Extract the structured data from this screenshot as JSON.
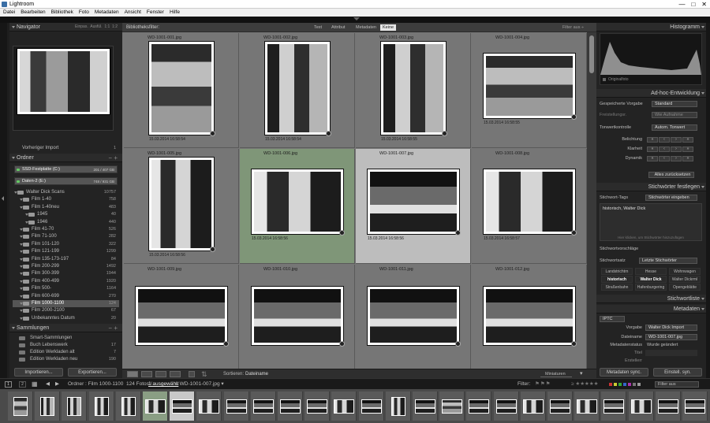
{
  "window": {
    "title": "Lightroom",
    "buttons": [
      "—",
      "□",
      "✕"
    ]
  },
  "menu": [
    "Datei",
    "Bearbeiten",
    "Bibliothek",
    "Foto",
    "Metadaten",
    "Ansicht",
    "Fenster",
    "Hilfe"
  ],
  "left": {
    "navigator": {
      "title": "Navigator",
      "options": [
        "Einpas.",
        "Ausfül.",
        "1:1",
        "1:2"
      ]
    },
    "catalog_items": [
      {
        "label": "Vorheriger Import",
        "count": "1"
      }
    ],
    "folders": {
      "title": "Ordner",
      "drives": [
        {
          "label": "SSD-Festplatte (C:)",
          "info": "201 / 407 GB"
        },
        {
          "label": "Daten-2 (E:)",
          "info": "748 / 931 GB"
        }
      ],
      "items": [
        {
          "label": "Walter Dick Scans",
          "count": "10757",
          "level": 1
        },
        {
          "label": "Film 1-40",
          "count": "758",
          "level": 2
        },
        {
          "label": "Film 1-40neu",
          "count": "483",
          "level": 2
        },
        {
          "label": "1945",
          "count": "40",
          "level": 3
        },
        {
          "label": "1946",
          "count": "440",
          "level": 3
        },
        {
          "label": "Film 41-70",
          "count": "526",
          "level": 2
        },
        {
          "label": "Film 71-100",
          "count": "282",
          "level": 2
        },
        {
          "label": "Film 101-120",
          "count": "322",
          "level": 2
        },
        {
          "label": "Film 121-199",
          "count": "1299",
          "level": 2
        },
        {
          "label": "Film 135-173-197",
          "count": "84",
          "level": 2
        },
        {
          "label": "Film 200-299",
          "count": "1492",
          "level": 2
        },
        {
          "label": "Film 300-399",
          "count": "1944",
          "level": 2
        },
        {
          "label": "Film 400-499",
          "count": "1920",
          "level": 2
        },
        {
          "label": "Film 500-",
          "count": "1164",
          "level": 2
        },
        {
          "label": "Film 600-699",
          "count": "270",
          "level": 2
        },
        {
          "label": "Film 1000-1100",
          "count": "124",
          "level": 2,
          "selected": true
        },
        {
          "label": "Film 2000-2100",
          "count": "67",
          "level": 2
        },
        {
          "label": "Unbekanntes Datum",
          "count": "20",
          "level": 2
        }
      ]
    },
    "collections": {
      "title": "Sammlungen",
      "items": [
        {
          "label": "Smart-Sammlungen",
          "count": ""
        },
        {
          "label": "Buch Lebenswerk",
          "count": "17"
        },
        {
          "label": "Edition Werkladen alt",
          "count": "7"
        },
        {
          "label": "Edition Werkladen neu",
          "count": "190"
        }
      ]
    },
    "import_btn": "Importieren...",
    "export_btn": "Exportieren..."
  },
  "filter": {
    "title": "Bibliotheksfilter:",
    "tabs": [
      "Text",
      "Attribut",
      "Metadaten",
      "Keine"
    ],
    "active": "Keine",
    "preset": "Filter aus ÷"
  },
  "grid": [
    {
      "name": "WD-1001-001.jpg",
      "date": "15.03.2014 16:58:54",
      "tone": "a",
      "portrait": true
    },
    {
      "name": "WD-1001-002.jpg",
      "date": "15.03.2014 16:58:54",
      "tone": "b",
      "portrait": true
    },
    {
      "name": "WD-1001-003.jpg",
      "date": "15.03.2014 16:58:55",
      "tone": "b",
      "portrait": true
    },
    {
      "name": "WD-1001-004.jpg",
      "date": "15.03.2014 16:58:55",
      "tone": "a",
      "portrait": false
    },
    {
      "name": "WD-1001-005.jpg",
      "date": "15.03.2014 16:58:56",
      "tone": "c",
      "portrait": true
    },
    {
      "name": "WD-1001-006.jpg",
      "date": "15.03.2014 16:58:56",
      "tone": "c",
      "portrait": false
    },
    {
      "name": "WD-1001-007.jpg",
      "date": "15.03.2014 16:58:56",
      "tone": "d",
      "portrait": false
    },
    {
      "name": "WD-1001-008.jpg",
      "date": "15.03.2014 16:58:57",
      "tone": "c",
      "portrait": false
    },
    {
      "name": "WD-1001-009.jpg",
      "date": "",
      "tone": "d",
      "portrait": false
    },
    {
      "name": "WD-1001-010.jpg",
      "date": "",
      "tone": "d",
      "portrait": false
    },
    {
      "name": "WD-1001-011.jpg",
      "date": "",
      "tone": "d",
      "portrait": false
    },
    {
      "name": "WD-1001-012.jpg",
      "date": "",
      "tone": "d",
      "portrait": false
    }
  ],
  "toolbar": {
    "sort_label": "Sortieren:",
    "sort_value": "Dateiname",
    "thumb_label": "Miniaturen"
  },
  "right": {
    "histogram": {
      "title": "Histogramm",
      "original": "Originalfoto"
    },
    "quick": {
      "title": "Ad-hoc-Entwicklung",
      "preset_label": "Gespeicherte Vorgabe",
      "preset_value": "Standard",
      "crop_label": "Freistellungsr.",
      "crop_value": "Wie Aufnahme",
      "tone_label": "Tonwertkontrolle",
      "tone_value": "Autom. Tonwert",
      "rows": [
        "Belichtung",
        "Klarheit",
        "Dynamik"
      ],
      "reset": "Alles zurücksetzen"
    },
    "keywording": {
      "title": "Stichwörter festlegen",
      "tags_label": "Stichwort-Tags",
      "tags_value": "Stichwörter eingeben",
      "text": "historisch, Walter Dick",
      "hint": "Hier klicken, um Stichwörter hinzuzufügen",
      "suggest": "Stichwortvorschläge",
      "set_label": "Stichwortsatz",
      "set_value": "Letzte Stichwörter",
      "keywords": [
        "Landstrichtrn",
        "Hesse",
        "Wohnwagen",
        "historisch",
        "Walter Dick",
        "Walter Dickrml",
        "Straßenbahn",
        "Hafenburgering",
        "Opengeblätte"
      ]
    },
    "kwlist": {
      "title": "Stichwortliste"
    },
    "metadata": {
      "title": "Metadaten",
      "preset_label": "IPTC",
      "vorgabe_label": "Vorgabe",
      "vorgabe_value": "Walter Dick Import",
      "filename_label": "Dateiname",
      "filename_value": "WD-1001-007.jpg",
      "status_label": "Metadatenstatus",
      "status_value": "Wurde geändert",
      "title_label": "Titel",
      "caption_label": "Erstellerr"
    },
    "sync_meta": "Metadaten sync.",
    "sync_settings": "Einstell. syn."
  },
  "bottom": {
    "pages": [
      "1",
      "2"
    ],
    "path": "Ordner : Film 1000-1100",
    "count": "124 Fotos /",
    "selected": "1 ausgewählt",
    "current": "/ WD-1001-007.jpg ▾",
    "filter_label": "Filter:",
    "filter_value": "Filter aus"
  },
  "filmstrip_count": 26
}
